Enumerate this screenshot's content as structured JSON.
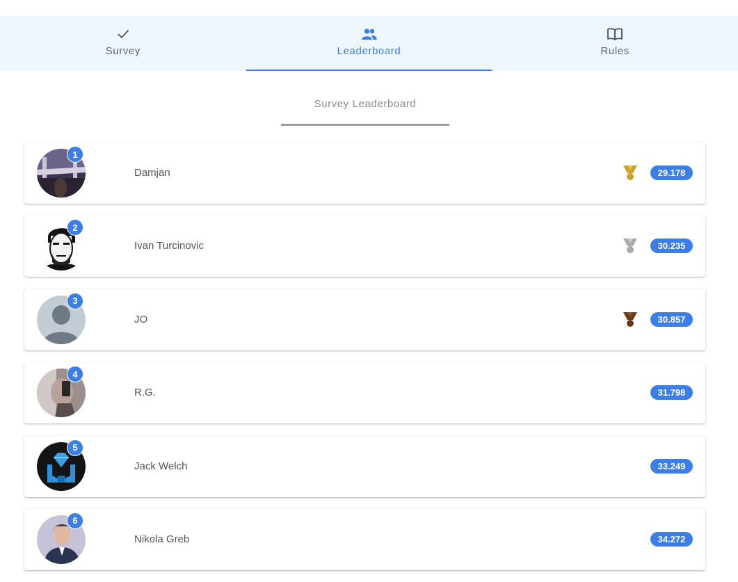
{
  "tabs": [
    {
      "label": "Survey",
      "icon": "check-icon",
      "active": false
    },
    {
      "label": "Leaderboard",
      "icon": "people-icon",
      "active": true
    },
    {
      "label": "Rules",
      "icon": "book-icon",
      "active": false
    }
  ],
  "section_title": "Survey Leaderboard",
  "colors": {
    "accent": "#3b7ee8",
    "gold": "#c9a227",
    "silver": "#a9a9a9",
    "bronze": "#6b3a10"
  },
  "leaderboard": [
    {
      "rank": "1",
      "name": "Damjan",
      "score": "29.178",
      "medal": "gold"
    },
    {
      "rank": "2",
      "name": "Ivan Turcinovic",
      "score": "30.235",
      "medal": "silver"
    },
    {
      "rank": "3",
      "name": "JO",
      "score": "30.857",
      "medal": "bronze"
    },
    {
      "rank": "4",
      "name": "R.G.",
      "score": "31.798",
      "medal": ""
    },
    {
      "rank": "5",
      "name": "Jack Welch",
      "score": "33.249",
      "medal": ""
    },
    {
      "rank": "6",
      "name": "Nikola Greb",
      "score": "34.272",
      "medal": ""
    }
  ]
}
